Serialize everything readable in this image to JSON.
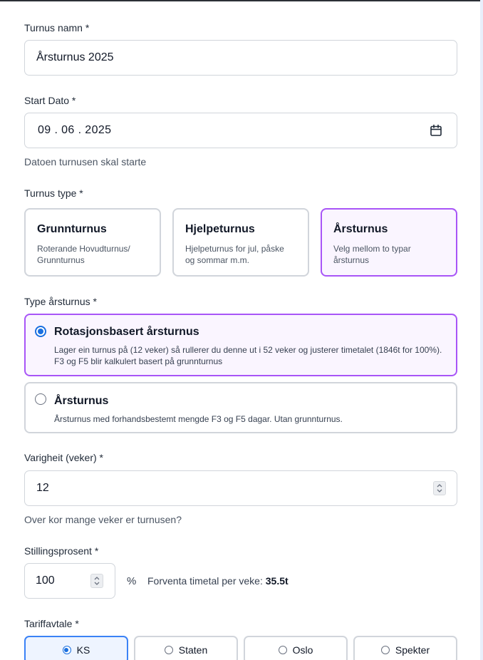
{
  "form": {
    "name": {
      "label": "Turnus namn *",
      "value": "Årsturnus 2025"
    },
    "start_date": {
      "label": "Start Dato *",
      "value": "09 . 06 . 2025",
      "help": "Datoen turnusen skal starte"
    },
    "turnus_type": {
      "label": "Turnus type *",
      "options": [
        {
          "title": "Grunnturnus",
          "desc": "Roterande Hovudturnus/ Grunnturnus",
          "selected": false
        },
        {
          "title": "Hjelpeturnus",
          "desc": "Hjelpeturnus for jul, påske og sommar m.m.",
          "selected": false
        },
        {
          "title": "Årsturnus",
          "desc": "Velg mellom to typar årsturnus",
          "selected": true
        }
      ]
    },
    "arsturnus_type": {
      "label": "Type årsturnus *",
      "options": [
        {
          "title": "Rotasjonsbasert årsturnus",
          "desc": "Lager ein turnus på (12 veker) så rullerer du denne ut i 52 veker og justerer timetalet (1846t for 100%). F3 og F5 blir kalkulert basert på grunnturnus",
          "selected": true
        },
        {
          "title": "Årsturnus",
          "desc": "Årsturnus med forhandsbestemt mengde F3 og F5 dagar. Utan grunnturnus.",
          "selected": false
        }
      ]
    },
    "duration": {
      "label": "Varigheit (veker) *",
      "value": "12",
      "help": "Over kor mange veker er turnusen?"
    },
    "percentage": {
      "label": "Stillingsprosent *",
      "value": "100",
      "unit": "%",
      "forecast_label": "Forventa timetal per veke:",
      "forecast_value": "35.5t"
    },
    "tariff": {
      "label": "Tariffavtale *",
      "options": [
        {
          "label": "KS",
          "selected": true
        },
        {
          "label": "Staten",
          "selected": false
        },
        {
          "label": "Oslo",
          "selected": false
        },
        {
          "label": "Spekter",
          "selected": false
        }
      ]
    }
  },
  "colors": {
    "accent_purple": "#a855f7",
    "selected_bg": "#faf5ff",
    "radio_blue": "#1a6fe0",
    "tariff_selected_border": "#3b82f6"
  },
  "icons": {
    "date_picker": "calendar-icon",
    "stepper": "up-down-chevron-icon"
  }
}
